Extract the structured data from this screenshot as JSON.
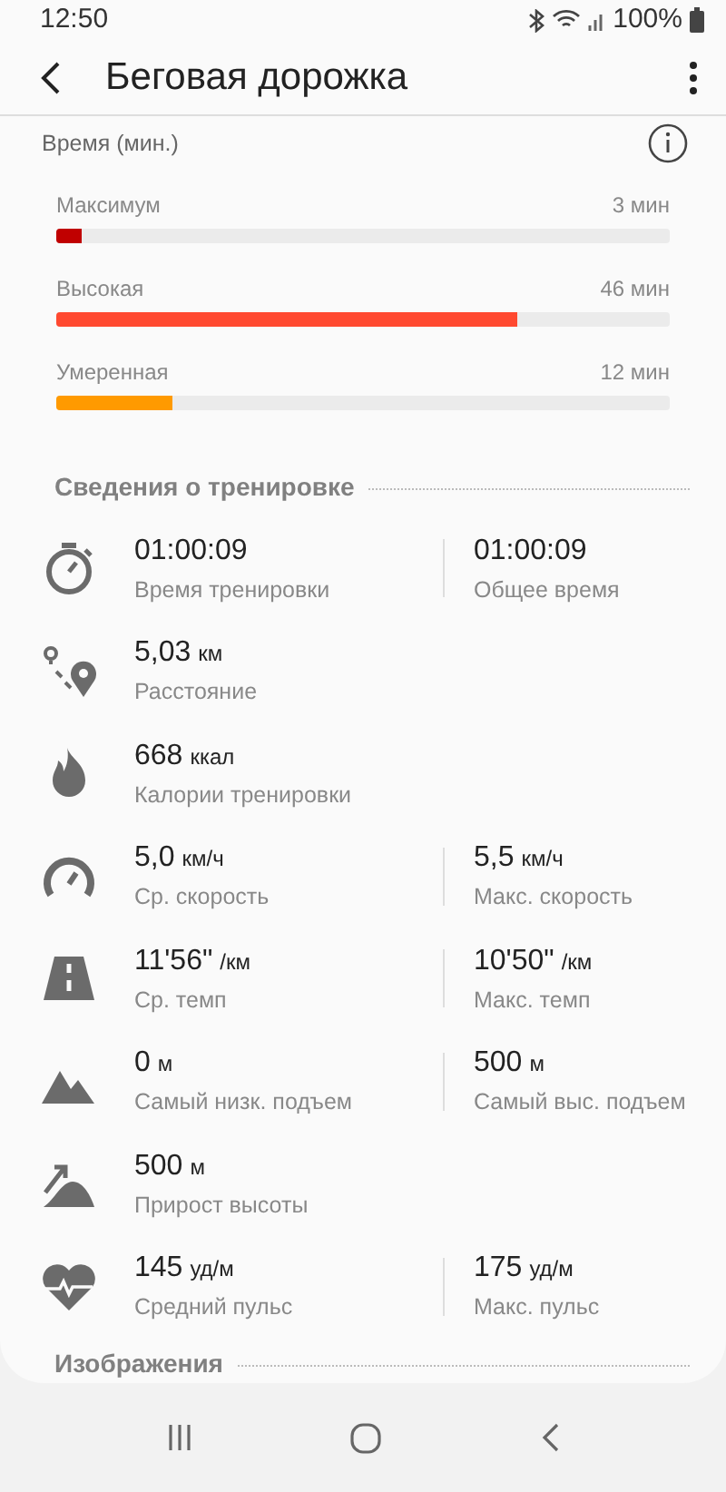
{
  "status_bar": {
    "time": "12:50",
    "battery": "100%"
  },
  "header": {
    "title": "Беговая дорожка"
  },
  "time_zones": {
    "title": "Время (мин.)",
    "zones": [
      {
        "label": "Максимум",
        "value": "3 мин",
        "level": 0.04,
        "color": "#c00000"
      },
      {
        "label": "Высокая",
        "value": "46 мин",
        "level": 0.75,
        "color": "#ff4930"
      },
      {
        "label": "Умеренная",
        "value": "12 мин",
        "level": 0.19,
        "color": "#ff9a00"
      }
    ]
  },
  "details": {
    "title": "Сведения о тренировке",
    "rows": [
      {
        "kind": "stopwatch",
        "stats": [
          {
            "value": "01:00:09",
            "label": "Время тренировки"
          },
          {
            "value": "01:00:09",
            "label": "Общее время"
          }
        ]
      },
      {
        "kind": "route",
        "stats": [
          {
            "value": "5,03",
            "unit": "км",
            "label": "Расстояние"
          }
        ]
      },
      {
        "kind": "flame",
        "stats": [
          {
            "value": "668",
            "unit": "ккал",
            "label": "Калории тренировки"
          }
        ]
      },
      {
        "kind": "speedometer",
        "stats": [
          {
            "value": "5,0",
            "unit": "км/ч",
            "label": "Ср. скорость"
          },
          {
            "value": "5,5",
            "unit": "км/ч",
            "label": "Макс. скорость"
          }
        ]
      },
      {
        "kind": "road",
        "stats": [
          {
            "value": "11'56\"",
            "unit": "/км",
            "label": "Ср. темп"
          },
          {
            "value": "10'50\"",
            "unit": "/км",
            "label": "Макс. темп"
          }
        ]
      },
      {
        "kind": "mountain",
        "stats": [
          {
            "value": "0",
            "unit": "м",
            "label": "Самый низк. подъем"
          },
          {
            "value": "500",
            "unit": "м",
            "label": "Самый выс. подъем"
          }
        ]
      },
      {
        "kind": "ascent",
        "stats": [
          {
            "value": "500",
            "unit": "м",
            "label": "Прирост высоты"
          }
        ]
      },
      {
        "kind": "heart",
        "stats": [
          {
            "value": "145",
            "unit": "уд/м",
            "label": "Средний пульс"
          },
          {
            "value": "175",
            "unit": "уд/м",
            "label": "Макс. пульс"
          }
        ]
      }
    ]
  },
  "images_section": {
    "title": "Изображения"
  }
}
